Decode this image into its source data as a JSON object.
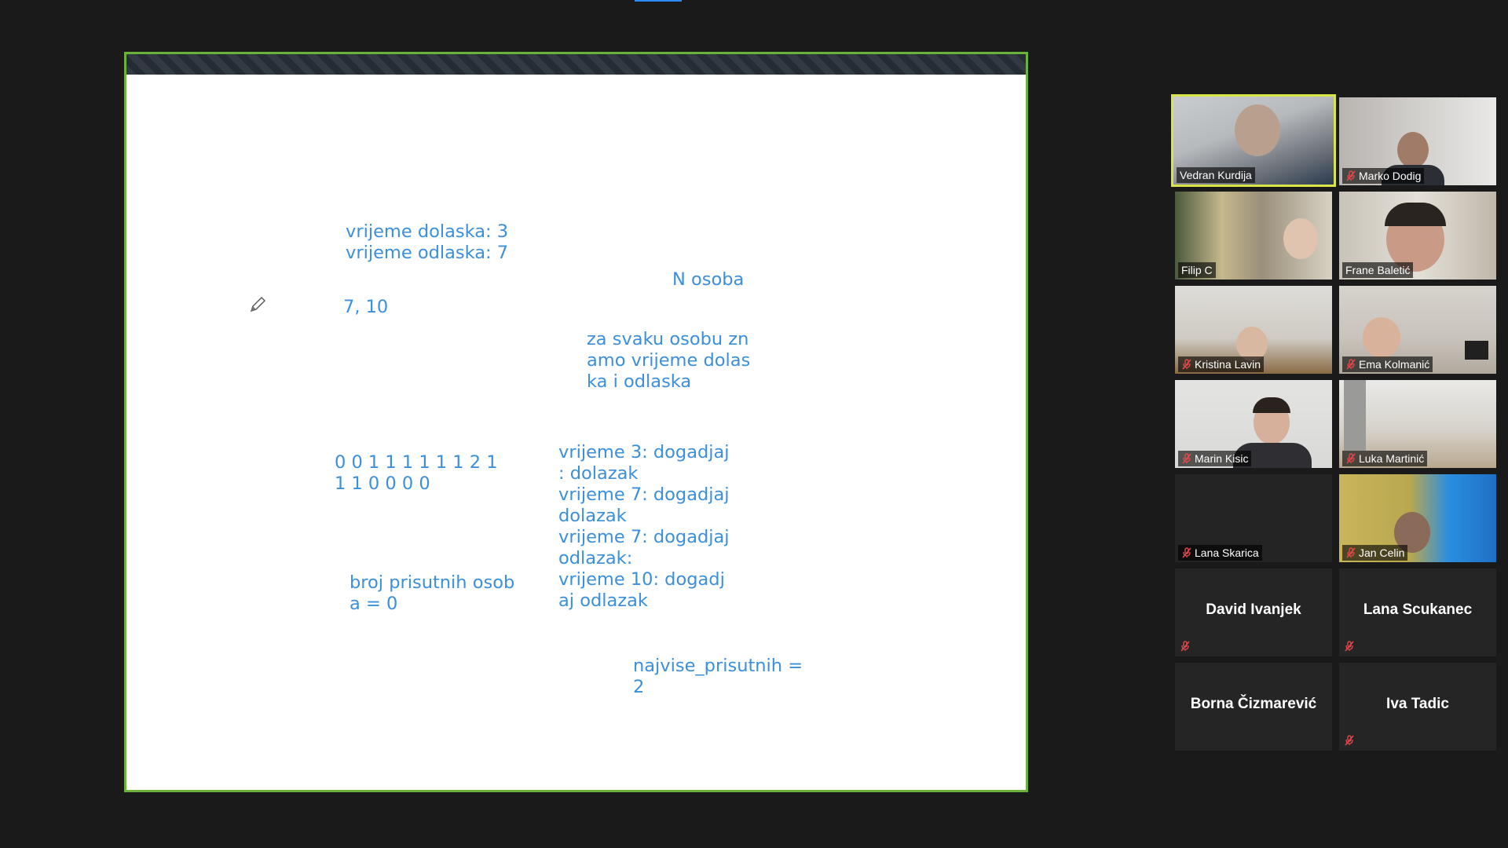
{
  "whiteboard": {
    "arrival": "vrijeme dolaska: 3",
    "departure": "vrijeme odlaska: 7",
    "pair": "7, 10",
    "n_people": "N osoba",
    "every_person_1": "za svaku osobu zn",
    "every_person_2": "amo vrijeme dolas",
    "every_person_3": "ka i odlaska",
    "sequence_1": "0 0 1 1 1 1 1 1 2 1",
    "sequence_2": "1 1 0 0 0 0",
    "events": [
      "vrijeme 3: dogadjaj",
      ": dolazak",
      "vrijeme 7: dogadjaj",
      "dolazak",
      "vrijeme 7: dogadjaj",
      "odlazak:",
      "vrijeme 10: dogadj",
      "aj odlazak"
    ],
    "present_1": "broj prisutnih osob",
    "present_2": "a = 0",
    "max_1": "najvise_prisutnih =",
    "max_2": "2"
  },
  "participants": [
    {
      "name": "Vedran Kurdija",
      "muted": false,
      "active": true
    },
    {
      "name": "Marko Dodig",
      "muted": true
    },
    {
      "name": "Filip C",
      "muted": false
    },
    {
      "name": "Frane Baletić",
      "muted": false
    },
    {
      "name": "Kristina Lavin",
      "muted": true
    },
    {
      "name": "Ema Kolmanić",
      "muted": true
    },
    {
      "name": "Marin Kisic",
      "muted": true
    },
    {
      "name": "Luka Martinić",
      "muted": true
    },
    {
      "name": "Lana Skarica",
      "muted": true
    },
    {
      "name": "Jan Celin",
      "muted": true
    },
    {
      "name": "David Ivanjek",
      "muted": true
    },
    {
      "name": "Lana Scukanec",
      "muted": true
    },
    {
      "name": "Borna Čizmarević",
      "muted": false
    },
    {
      "name": "Iva Tadic",
      "muted": true
    }
  ],
  "colors": {
    "share_border": "#6bb23a",
    "active_speaker": "#d8e44a",
    "whiteboard_text": "#3b8fdb",
    "mute_red": "#e5484d"
  }
}
